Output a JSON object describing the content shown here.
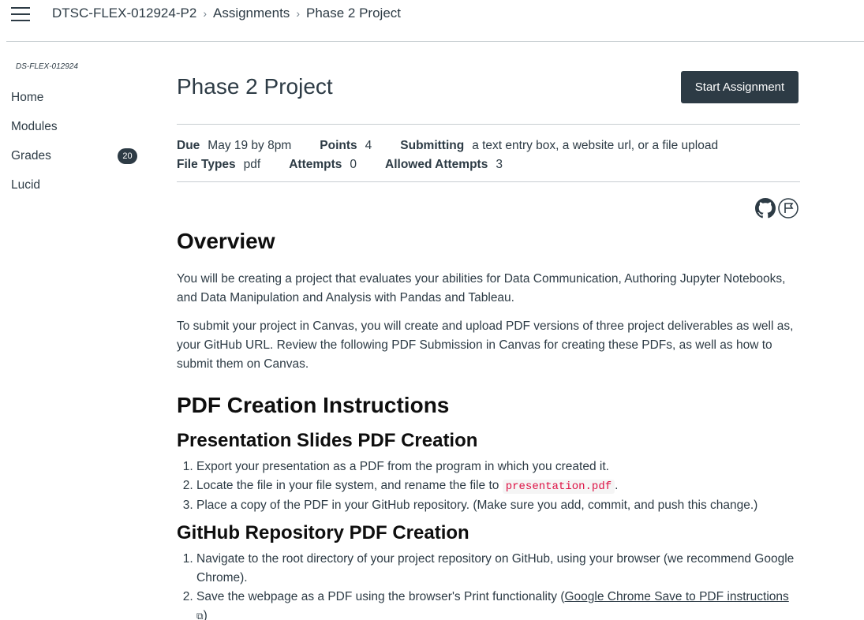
{
  "header": {
    "breadcrumbs": [
      "DTSC-FLEX-012924-P2",
      "Assignments",
      "Phase 2 Project"
    ]
  },
  "sidebar": {
    "course_code": "DS-FLEX-012924",
    "items": [
      {
        "label": "Home"
      },
      {
        "label": "Modules"
      },
      {
        "label": "Grades",
        "badge": "20"
      },
      {
        "label": "Lucid"
      }
    ]
  },
  "assignment": {
    "title": "Phase 2 Project",
    "start_label": "Start Assignment",
    "details": {
      "due_label": "Due",
      "due_value": "May 19 by 8pm",
      "points_label": "Points",
      "points_value": "4",
      "submitting_label": "Submitting",
      "submitting_value": "a text entry box, a website url, or a file upload",
      "filetypes_label": "File Types",
      "filetypes_value": "pdf",
      "attempts_label": "Attempts",
      "attempts_value": "0",
      "allowed_label": "Allowed Attempts",
      "allowed_value": "3"
    }
  },
  "content": {
    "overview_heading": "Overview",
    "overview_p1": "You will be creating a project that evaluates your abilities for Data Communication, Authoring Jupyter Notebooks, and Data Manipulation and Analysis with Pandas and Tableau.",
    "overview_p2": "To submit your project in Canvas, you will create and upload PDF versions of three project deliverables as well as, your GitHub URL. Review the following PDF Submission in Canvas for creating these PDFs, as well as how to submit them on Canvas.",
    "pdf_heading": "PDF Creation Instructions",
    "slides_heading": "Presentation Slides PDF Creation",
    "slides_step1": "Export your presentation as a PDF from the program in which you created it.",
    "slides_step2_pre": "Locate the file in your file system, and rename the file to ",
    "slides_step2_code": "presentation.pdf",
    "slides_step2_post": ".",
    "slides_step3": "Place a copy of the PDF in your GitHub repository. (Make sure you add, commit, and push this change.)",
    "github_heading": "GitHub Repository PDF Creation",
    "github_step1": "Navigate to the root directory of your project repository on GitHub, using your browser (we recommend Google Chrome).",
    "github_step2_pre": "Save the webpage as a PDF using the browser's Print functionality (",
    "github_step2_link": "Google Chrome Save to PDF instructions",
    "github_step2_post": ")"
  },
  "icons": [
    "menu-icon",
    "chevron-right-icon",
    "github-icon",
    "flag-icon",
    "external-link-icon"
  ]
}
